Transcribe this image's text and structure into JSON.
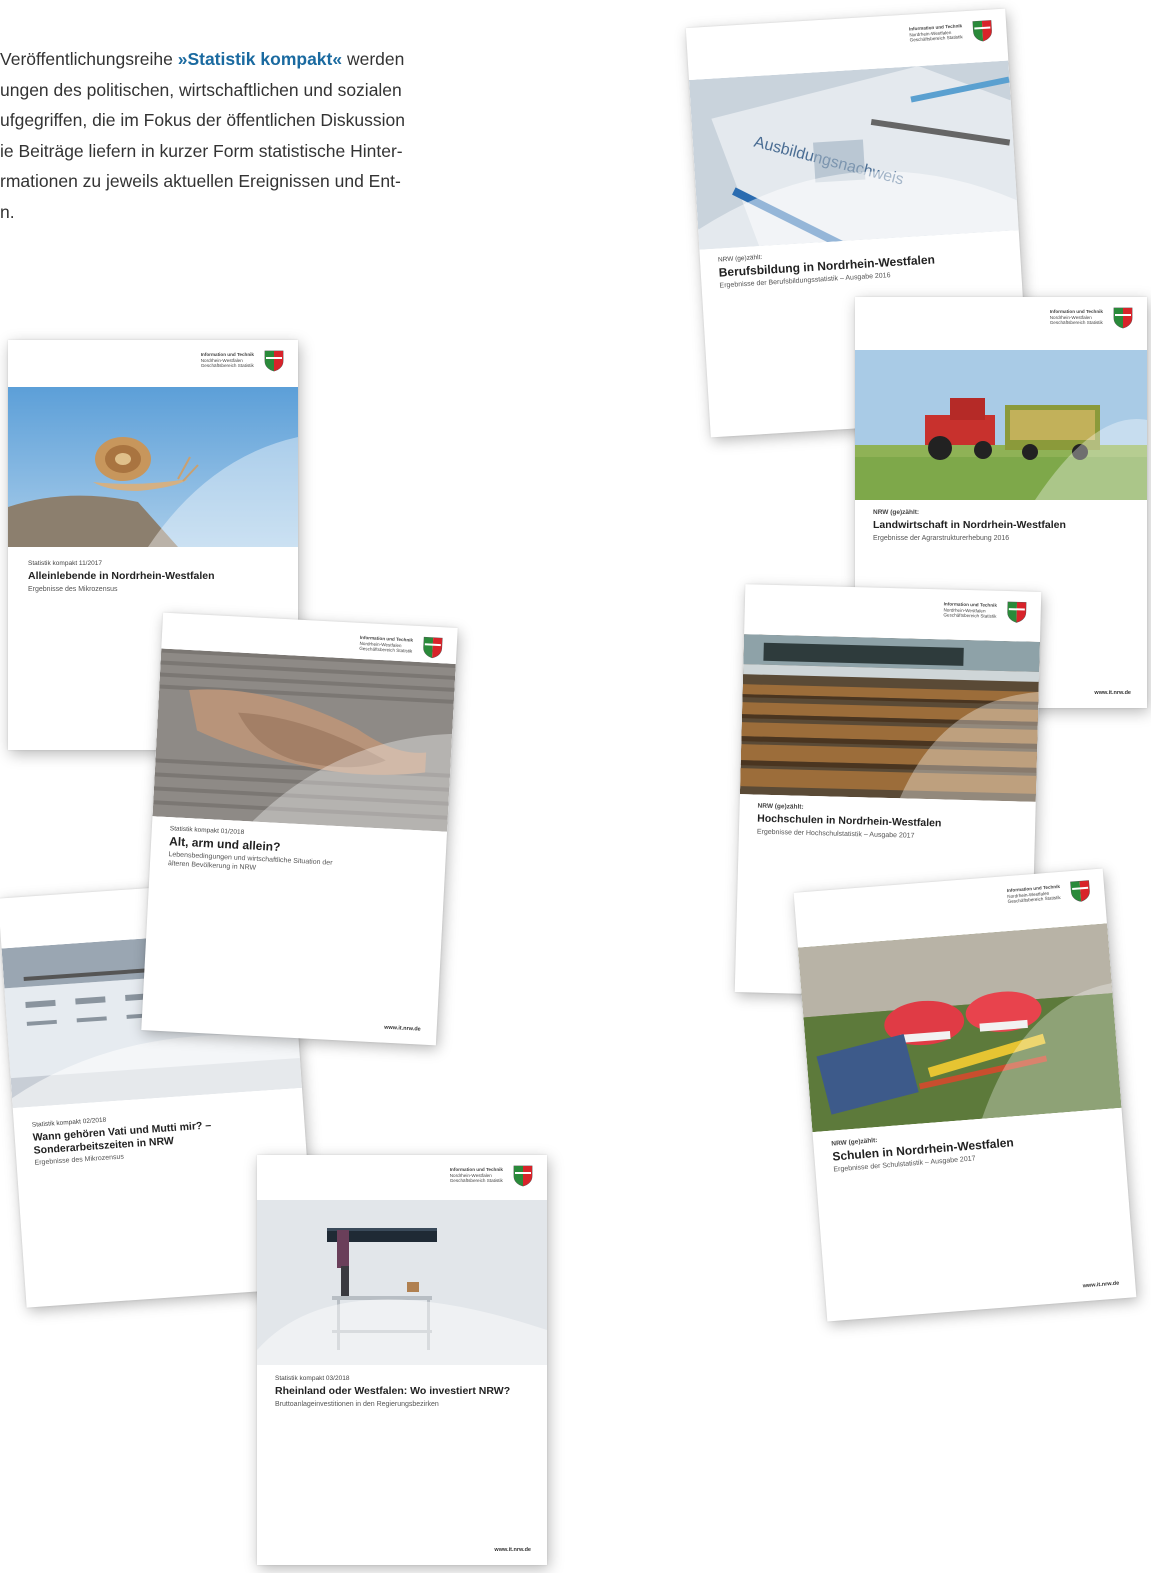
{
  "intro": {
    "line1_pre": "Veröffentlichungsreihe ",
    "line1_highlight": "»Statistik kompakt«",
    "line1_post": " werden",
    "line2": "ungen des politischen, wirtschaftlichen und sozialen",
    "line3": "ufgegriffen, die im Fokus der öffentlichen Diskussion",
    "line4": "ie Beiträge liefern in kurzer Form statistische Hinter-",
    "line5": "rmationen zu jeweils aktuellen Ereignissen und Ent-",
    "line6": "n."
  },
  "org": {
    "line1": "Information und Technik",
    "line2": "Nordrhein-Westfalen",
    "line3": "Geschäftsbereich Statistik"
  },
  "url": "www.it.nrw.de",
  "colors": {
    "accent": "#1a6aa0",
    "crest_green": "#2a8a3a",
    "crest_red": "#d8232a"
  },
  "covers": {
    "alleinlebende": {
      "series": "Statistik kompakt 11/2017",
      "title": "Alleinlebende in Nordrhein-Westfalen",
      "subtitle": "Ergebnisse des Mikrozensus",
      "image": "snail-photo"
    },
    "alt_arm": {
      "series": "Statistik kompakt 01/2018",
      "title": "Alt, arm und allein?",
      "subtitle": "Lebensbedingungen und wirtschaftliche Situation der älteren Bevölkerung in NRW",
      "image": "hands-photo"
    },
    "sonderarbeitszeiten": {
      "series": "Statistik kompakt 02/2018",
      "title": "Wann gehören Vati und Mutti mir? – Sonderarbeitszeiten in NRW",
      "subtitle": "Ergebnisse des Mikrozensus",
      "image": "calendar-photo"
    },
    "rheinland": {
      "series": "Statistik kompakt 03/2018",
      "title": "Rheinland oder Westfalen: Wo investiert NRW?",
      "subtitle": "Bruttoanlageinvestitionen in den Regierungsbezirken",
      "image": "worker-photo"
    },
    "berufsbildung": {
      "series": "NRW (ge)zählt:",
      "title": "Berufsbildung in Nordrhein-Westfalen",
      "subtitle": "Ergebnisse der Berufsbildungsstatistik – Ausgabe 2016",
      "image": "document-photo"
    },
    "landwirtschaft": {
      "series": "NRW (ge)zählt:",
      "title": "Landwirtschaft in Nordrhein-Westfalen",
      "subtitle": "Ergebnisse der Agrarstrukturerhebung 2016",
      "image": "tractor-photo"
    },
    "hochschulen": {
      "series": "NRW (ge)zählt:",
      "title": "Hochschulen in Nordrhein-Westfalen",
      "subtitle": "Ergebnisse der Hochschulstatistik – Ausgabe 2017",
      "image": "lecture-hall-photo"
    },
    "schulen": {
      "series": "NRW (ge)zählt:",
      "title": "Schulen in Nordrhein-Westfalen",
      "subtitle": "Ergebnisse der Schulstatistik – Ausgabe 2017",
      "image": "sneakers-photo"
    }
  }
}
